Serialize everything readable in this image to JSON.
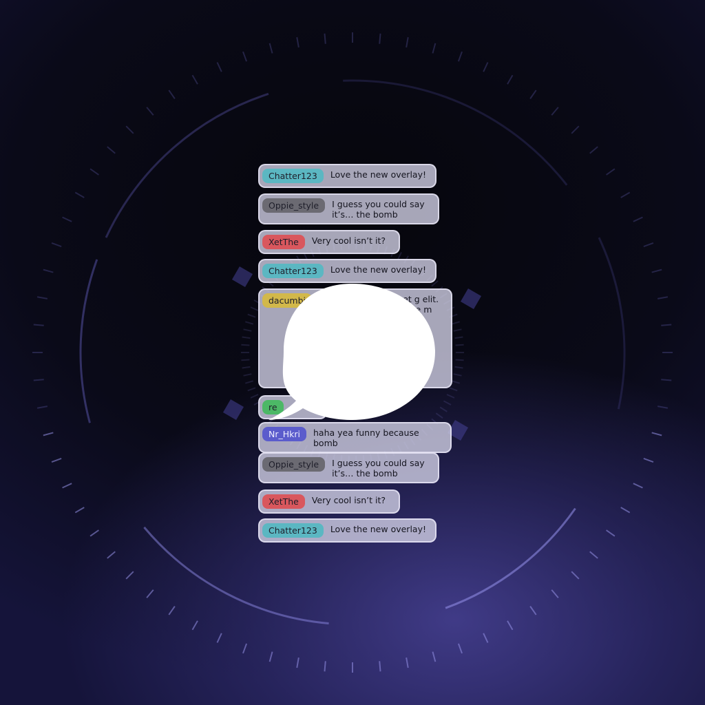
{
  "chat": {
    "messages": [
      {
        "user": "Chatter123",
        "text": "Love the new overlay!",
        "color": "#5bb7c2"
      },
      {
        "user": "Oppie_style",
        "text": "I guess you could say it’s… the bomb",
        "color": "#6b6a72"
      },
      {
        "user": "XetThe",
        "text": "Very cool isn’t it?",
        "color": "#d9575d"
      },
      {
        "user": "Chatter123",
        "text": "Love the new overlay!",
        "color": "#5bb7c2"
      },
      {
        "user": "dacumbi",
        "text": "it amet g elit. uas nte e m",
        "color": "#d2b84a"
      },
      {
        "user": "re",
        "text": "",
        "color": "#4cb866"
      },
      {
        "user": "Nr_Hkri",
        "text": "haha yea funny because bomb",
        "color": "#5b5ccc"
      },
      {
        "user": "Oppie_style",
        "text": "I guess you could say it’s… the bomb",
        "color": "#6b6a72"
      },
      {
        "user": "XetThe",
        "text": "Very cool isn’t it?",
        "color": "#d9575d"
      },
      {
        "user": "Chatter123",
        "text": "Love the new overlay!",
        "color": "#5bb7c2"
      }
    ]
  },
  "logo": {
    "icon": "speech-bubble-icon",
    "color": "#ffffff"
  },
  "theme": {
    "accent": "#4a45a0",
    "background": "#0a0a18"
  }
}
